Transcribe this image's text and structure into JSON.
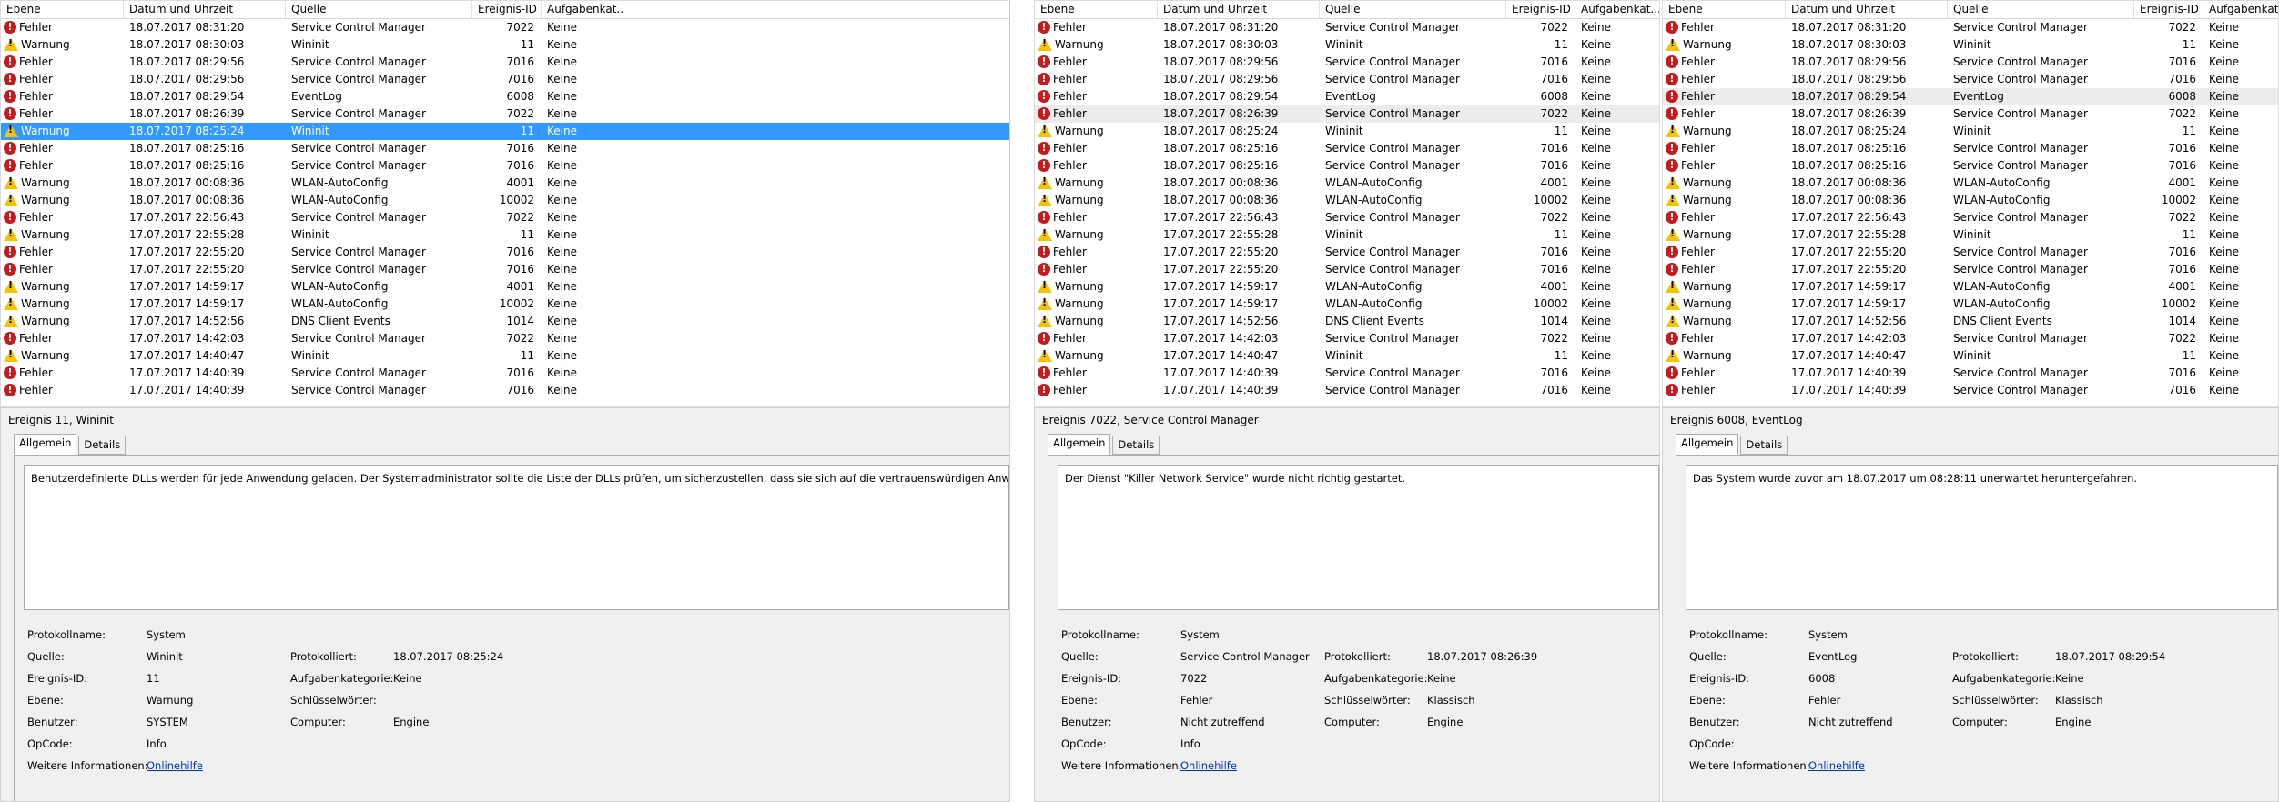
{
  "columns": {
    "level": "Ebene",
    "date": "Datum und Uhrzeit",
    "source": "Quelle",
    "id": "Ereignis-ID",
    "task": "Aufgabenkat..."
  },
  "rows": [
    {
      "icon": "err",
      "level": "Fehler",
      "date": "18.07.2017 08:31:20",
      "source": "Service Control Manager",
      "id": "7022",
      "task": "Keine"
    },
    {
      "icon": "warn",
      "level": "Warnung",
      "date": "18.07.2017 08:30:03",
      "source": "Wininit",
      "id": "11",
      "task": "Keine"
    },
    {
      "icon": "err",
      "level": "Fehler",
      "date": "18.07.2017 08:29:56",
      "source": "Service Control Manager",
      "id": "7016",
      "task": "Keine"
    },
    {
      "icon": "err",
      "level": "Fehler",
      "date": "18.07.2017 08:29:56",
      "source": "Service Control Manager",
      "id": "7016",
      "task": "Keine"
    },
    {
      "icon": "err",
      "level": "Fehler",
      "date": "18.07.2017 08:29:54",
      "source": "EventLog",
      "id": "6008",
      "task": "Keine"
    },
    {
      "icon": "err",
      "level": "Fehler",
      "date": "18.07.2017 08:26:39",
      "source": "Service Control Manager",
      "id": "7022",
      "task": "Keine"
    },
    {
      "icon": "warn",
      "level": "Warnung",
      "date": "18.07.2017 08:25:24",
      "source": "Wininit",
      "id": "11",
      "task": "Keine"
    },
    {
      "icon": "err",
      "level": "Fehler",
      "date": "18.07.2017 08:25:16",
      "source": "Service Control Manager",
      "id": "7016",
      "task": "Keine"
    },
    {
      "icon": "err",
      "level": "Fehler",
      "date": "18.07.2017 08:25:16",
      "source": "Service Control Manager",
      "id": "7016",
      "task": "Keine"
    },
    {
      "icon": "warn",
      "level": "Warnung",
      "date": "18.07.2017 00:08:36",
      "source": "WLAN-AutoConfig",
      "id": "4001",
      "task": "Keine"
    },
    {
      "icon": "warn",
      "level": "Warnung",
      "date": "18.07.2017 00:08:36",
      "source": "WLAN-AutoConfig",
      "id": "10002",
      "task": "Keine"
    },
    {
      "icon": "err",
      "level": "Fehler",
      "date": "17.07.2017 22:56:43",
      "source": "Service Control Manager",
      "id": "7022",
      "task": "Keine"
    },
    {
      "icon": "warn",
      "level": "Warnung",
      "date": "17.07.2017 22:55:28",
      "source": "Wininit",
      "id": "11",
      "task": "Keine"
    },
    {
      "icon": "err",
      "level": "Fehler",
      "date": "17.07.2017 22:55:20",
      "source": "Service Control Manager",
      "id": "7016",
      "task": "Keine"
    },
    {
      "icon": "err",
      "level": "Fehler",
      "date": "17.07.2017 22:55:20",
      "source": "Service Control Manager",
      "id": "7016",
      "task": "Keine"
    },
    {
      "icon": "warn",
      "level": "Warnung",
      "date": "17.07.2017 14:59:17",
      "source": "WLAN-AutoConfig",
      "id": "4001",
      "task": "Keine"
    },
    {
      "icon": "warn",
      "level": "Warnung",
      "date": "17.07.2017 14:59:17",
      "source": "WLAN-AutoConfig",
      "id": "10002",
      "task": "Keine"
    },
    {
      "icon": "warn",
      "level": "Warnung",
      "date": "17.07.2017 14:52:56",
      "source": "DNS Client Events",
      "id": "1014",
      "task": "Keine"
    },
    {
      "icon": "err",
      "level": "Fehler",
      "date": "17.07.2017 14:42:03",
      "source": "Service Control Manager",
      "id": "7022",
      "task": "Keine"
    },
    {
      "icon": "warn",
      "level": "Warnung",
      "date": "17.07.2017 14:40:47",
      "source": "Wininit",
      "id": "11",
      "task": "Keine"
    },
    {
      "icon": "err",
      "level": "Fehler",
      "date": "17.07.2017 14:40:39",
      "source": "Service Control Manager",
      "id": "7016",
      "task": "Keine"
    },
    {
      "icon": "err",
      "level": "Fehler",
      "date": "17.07.2017 14:40:39",
      "source": "Service Control Manager",
      "id": "7016",
      "task": "Keine"
    }
  ],
  "tabs": {
    "general": "Allgemein",
    "details": "Details"
  },
  "labels": {
    "log": "Protokollname:",
    "source": "Quelle:",
    "eventid": "Ereignis-ID:",
    "level": "Ebene:",
    "user": "Benutzer:",
    "opcode": "OpCode:",
    "more": "Weitere Informationen:",
    "logged": "Protokolliert:",
    "task": "Aufgabenkategorie:",
    "keywords": "Schlüsselwörter:",
    "computer": "Computer:"
  },
  "panels": [
    {
      "selected_row": 6,
      "hover_row": -1,
      "title": "Ereignis 11, Wininit",
      "message": "Benutzerdefinierte DLLs werden für jede Anwendung geladen. Der Systemadministrator sollte die Liste der DLLs prüfen, um sicherzustellen, dass sie sich auf die vertrauenswürdigen Anwendungen beziehen.",
      "log": "System",
      "source": "Wininit",
      "eventid": "11",
      "level": "Warnung",
      "user": "SYSTEM",
      "opcode": "Info",
      "more": "Onlinehilfe",
      "logged": "18.07.2017 08:25:24",
      "task": "Keine",
      "keywords": "",
      "computer": "Engine"
    },
    {
      "selected_row": -1,
      "hover_row": 5,
      "title": "Ereignis 7022, Service Control Manager",
      "message": "Der Dienst \"Killer Network Service\" wurde nicht richtig gestartet.",
      "log": "System",
      "source": "Service Control Manager",
      "eventid": "7022",
      "level": "Fehler",
      "user": "Nicht zutreffend",
      "opcode": "Info",
      "more": "Onlinehilfe",
      "logged": "18.07.2017 08:26:39",
      "task": "Keine",
      "keywords": "Klassisch",
      "computer": "Engine"
    },
    {
      "selected_row": -1,
      "hover_row": 4,
      "title": "Ereignis 6008, EventLog",
      "message": "Das System wurde zuvor am 18.07.2017 um 08:28:11 unerwartet heruntergefahren.",
      "log": "System",
      "source": "EventLog",
      "eventid": "6008",
      "level": "Fehler",
      "user": "Nicht zutreffend",
      "opcode": "",
      "more": "Onlinehilfe",
      "logged": "18.07.2017 08:29:54",
      "task": "Keine",
      "keywords": "Klassisch",
      "computer": "Engine"
    }
  ]
}
